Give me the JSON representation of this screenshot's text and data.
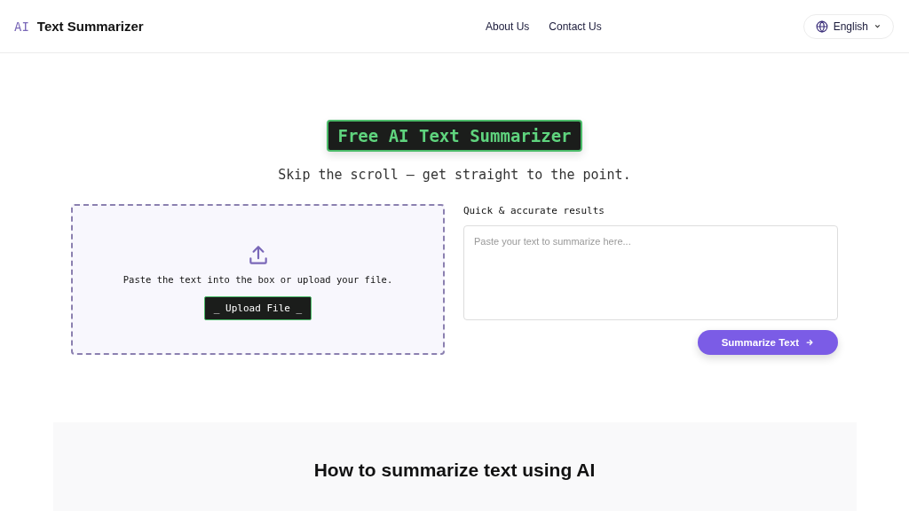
{
  "header": {
    "logo_mark": "AI",
    "brand": "Text Summarizer",
    "nav": [
      "About Us",
      "Contact Us"
    ],
    "language": "English"
  },
  "hero": {
    "title": "Free AI Text Summarizer",
    "subtitle": "Skip the scroll — get straight to the point."
  },
  "upload": {
    "instruction": "Paste the text into the box or upload your file.",
    "button": "_ Upload File _"
  },
  "input": {
    "label": "Quick & accurate results",
    "placeholder": "Paste your text to summarize here...",
    "button": "Summarize Text"
  },
  "how_to": {
    "heading": "How to summarize text using AI"
  }
}
